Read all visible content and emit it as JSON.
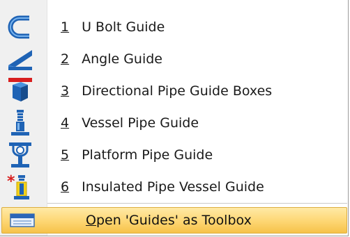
{
  "menu": {
    "items": [
      {
        "number": "1",
        "label": "U Bolt Guide",
        "icon": "u-bolt-icon"
      },
      {
        "number": "2",
        "label": "Angle Guide",
        "icon": "angle-guide-icon"
      },
      {
        "number": "3",
        "label": "Directional Pipe Guide Boxes",
        "icon": "directional-guide-box-icon"
      },
      {
        "number": "4",
        "label": "Vessel Pipe Guide",
        "icon": "vessel-guide-icon"
      },
      {
        "number": "5",
        "label": "Platform Pipe Guide",
        "icon": "platform-guide-icon"
      },
      {
        "number": "6",
        "label": "Insulated Pipe Vessel Guide",
        "icon": "insulated-vessel-guide-icon"
      }
    ],
    "toolbox": {
      "accel": "O",
      "label_rest": "pen 'Guides' as Toolbox",
      "icon": "toolbox-icon"
    },
    "colors": {
      "highlight": "#fdd672",
      "icon_blue": "#1f63b5",
      "icon_red": "#d81f1f",
      "icon_yellow": "#f3d21a"
    }
  }
}
